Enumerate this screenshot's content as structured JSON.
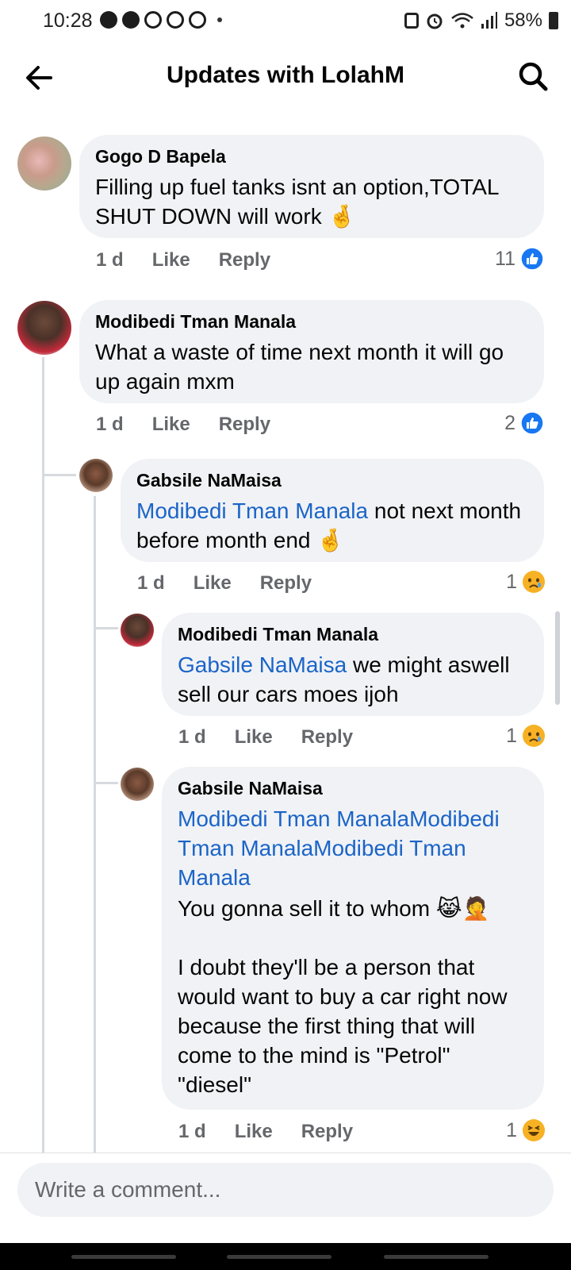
{
  "status_bar": {
    "time": "10:28",
    "battery": "58%"
  },
  "header": {
    "title": "Updates with LolahM"
  },
  "comments": [
    {
      "author": "Gogo D Bapela",
      "text": "Filling up fuel tanks isnt an option,TOTAL SHUT DOWN will work 🤞",
      "time": "1 d",
      "like": "Like",
      "reply": "Reply",
      "reaction_count": "11",
      "reaction": "like"
    },
    {
      "author": "Modibedi Tman Manala",
      "text": "What a waste of time next month it will go up again mxm",
      "time": "1 d",
      "like": "Like",
      "reply": "Reply",
      "reaction_count": "2",
      "reaction": "like"
    },
    {
      "author": "Gabsile NaMaisa",
      "mention": "Modibedi Tman Manala",
      "text": " not next month before month end 🤞",
      "time": "1 d",
      "like": "Like",
      "reply": "Reply",
      "reaction_count": "1",
      "reaction": "sad"
    },
    {
      "author": "Modibedi Tman Manala",
      "mention": "Gabsile NaMaisa",
      "text": " we might aswell sell our cars moes ijoh",
      "time": "1 d",
      "like": "Like",
      "reply": "Reply",
      "reaction_count": "1",
      "reaction": "sad"
    },
    {
      "author": "Gabsile NaMaisa",
      "mention": "Modibedi Tman ManalaModibedi Tman ManalaModibedi Tman Manala",
      "text": "You gonna sell it to whom 😹🤦\n\n I doubt they'll be a person that would want to buy a car right now because the first thing that will come to the mind is \"Petrol\" \"diesel\"",
      "time": "1 d",
      "like": "Like",
      "reply": "Reply",
      "reaction_count": "1",
      "reaction": "haha"
    }
  ],
  "composer": {
    "placeholder": "Write a comment..."
  }
}
